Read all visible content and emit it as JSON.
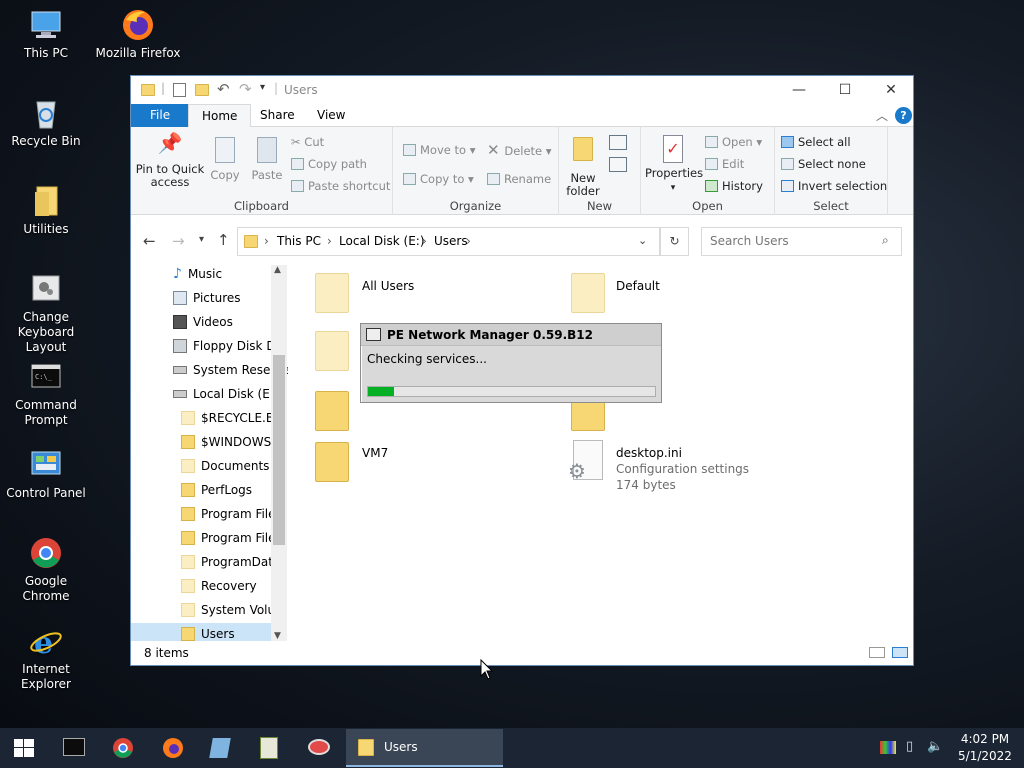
{
  "desktop": {
    "icons": [
      {
        "label": "This PC",
        "icon": "computer-icon"
      },
      {
        "label": "Mozilla Firefox",
        "icon": "firefox-icon"
      },
      {
        "label": "Recycle Bin",
        "icon": "recycle-bin-icon"
      },
      {
        "label": "Utilities",
        "icon": "folder-icon"
      },
      {
        "label": "Change Keyboard Layout",
        "icon": "keyboard-icon"
      },
      {
        "label": "Command Prompt",
        "icon": "cmd-icon"
      },
      {
        "label": "Control Panel",
        "icon": "control-panel-icon"
      },
      {
        "label": "Google Chrome",
        "icon": "chrome-icon"
      },
      {
        "label": "Internet Explorer",
        "icon": "ie-icon"
      }
    ]
  },
  "window": {
    "title": "Users",
    "tabs": [
      "File",
      "Home",
      "Share",
      "View"
    ],
    "ribbon": {
      "clipboard": {
        "label": "Clipboard",
        "pin": "Pin to Quick access",
        "copy": "Copy",
        "paste": "Paste",
        "cut": "Cut",
        "copy_path": "Copy path",
        "paste_shortcut": "Paste shortcut"
      },
      "organize": {
        "label": "Organize",
        "move_to": "Move to",
        "copy_to": "Copy to",
        "delete": "Delete",
        "rename": "Rename"
      },
      "new": {
        "label": "New",
        "new_folder": "New folder"
      },
      "open": {
        "label": "Open",
        "properties": "Properties",
        "open": "Open",
        "edit": "Edit",
        "history": "History"
      },
      "select": {
        "label": "Select",
        "select_all": "Select all",
        "select_none": "Select none",
        "invert": "Invert selection"
      }
    },
    "address": {
      "crumbs": [
        "This PC",
        "Local Disk (E:)",
        "Users"
      ],
      "search_placeholder": "Search Users"
    },
    "nav": [
      {
        "label": "Music",
        "type": "music"
      },
      {
        "label": "Pictures",
        "type": "pictures"
      },
      {
        "label": "Videos",
        "type": "videos"
      },
      {
        "label": "Floppy Disk Dri",
        "type": "floppy"
      },
      {
        "label": "System Reserve",
        "type": "drive"
      },
      {
        "label": "Local Disk (E:)",
        "type": "drive"
      },
      {
        "label": "$RECYCLE.BIN",
        "type": "pale"
      },
      {
        "label": "$WINDOWS.~",
        "type": "folder"
      },
      {
        "label": "Documents a",
        "type": "pale"
      },
      {
        "label": "PerfLogs",
        "type": "folder"
      },
      {
        "label": "Program Files",
        "type": "folder"
      },
      {
        "label": "Program Files",
        "type": "folder"
      },
      {
        "label": "ProgramData",
        "type": "pale"
      },
      {
        "label": "Recovery",
        "type": "pale"
      },
      {
        "label": "System Volun",
        "type": "pale"
      },
      {
        "label": "Users",
        "type": "folder"
      }
    ],
    "files": [
      {
        "name": "All Users"
      },
      {
        "name": "Default"
      },
      {
        "name": "VM7"
      },
      {
        "name": "desktop.ini",
        "type": "Configuration settings",
        "size": "174 bytes"
      }
    ],
    "status": "8 items"
  },
  "dialog": {
    "title": "PE Network Manager 0.59.B12",
    "message": "Checking services...",
    "progress": 0.09
  },
  "taskbar": {
    "active_label": "Users",
    "time": "4:02 PM",
    "date": "5/1/2022"
  },
  "colors": {
    "accent": "#1979ca",
    "progress": "#06b025",
    "folder": "#f7d774"
  }
}
